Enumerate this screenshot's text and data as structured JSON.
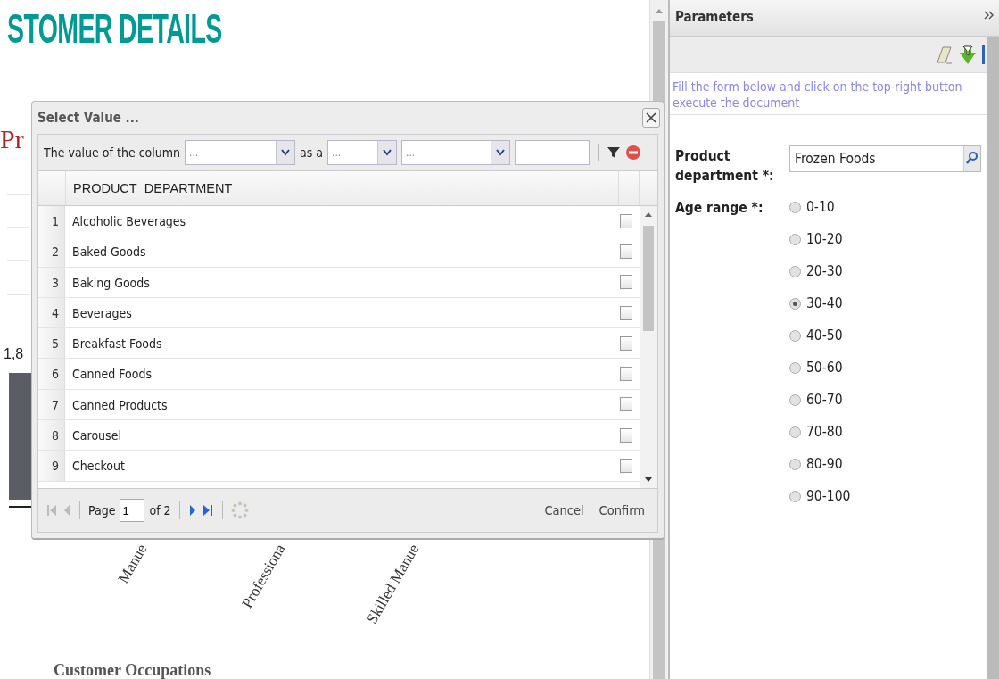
{
  "report": {
    "title": "STOMER DETAILS",
    "chart": {
      "title": "Pr",
      "value_label": "1,8",
      "categories": [
        "Manue",
        "Professiona",
        "Skilled Manue"
      ],
      "xlabel": "Customer Occupations"
    }
  },
  "dialog": {
    "title": "Select Value ...",
    "filter": {
      "label": "The value of the column",
      "column_select": "...",
      "connector": "as a",
      "operator_select": "...",
      "type_select": "..."
    },
    "grid": {
      "columns": [
        "PRODUCT_DEPARTMENT"
      ],
      "rows": [
        {
          "index": "1",
          "value": "Alcoholic Beverages",
          "checked": false
        },
        {
          "index": "2",
          "value": "Baked Goods",
          "checked": false
        },
        {
          "index": "3",
          "value": "Baking Goods",
          "checked": false
        },
        {
          "index": "4",
          "value": "Beverages",
          "checked": false
        },
        {
          "index": "5",
          "value": "Breakfast Foods",
          "checked": false
        },
        {
          "index": "6",
          "value": "Canned Foods",
          "checked": false
        },
        {
          "index": "7",
          "value": "Canned Products",
          "checked": false
        },
        {
          "index": "8",
          "value": "Carousel",
          "checked": false
        },
        {
          "index": "9",
          "value": "Checkout",
          "checked": false
        }
      ]
    },
    "pager": {
      "page_label": "Page",
      "page": "1",
      "of": "of 2"
    },
    "buttons": [
      "Cancel",
      "Confirm"
    ]
  },
  "parameters": {
    "title": "Parameters",
    "hint": "Fill the form below and click on the top-right button execute the document",
    "fields": [
      {
        "kind": "lookup",
        "label": "Product department *:",
        "value": "Frozen Foods"
      },
      {
        "kind": "radio",
        "label": "Age range *:",
        "options": [
          {
            "label": "0-10",
            "selected": false
          },
          {
            "label": "10-20",
            "selected": false
          },
          {
            "label": "20-30",
            "selected": false
          },
          {
            "label": "30-40",
            "selected": true
          },
          {
            "label": "40-50",
            "selected": false
          },
          {
            "label": "50-60",
            "selected": false
          },
          {
            "label": "60-70",
            "selected": false
          },
          {
            "label": "70-80",
            "selected": false
          },
          {
            "label": "80-90",
            "selected": false
          },
          {
            "label": "90-100",
            "selected": false
          }
        ]
      }
    ]
  }
}
